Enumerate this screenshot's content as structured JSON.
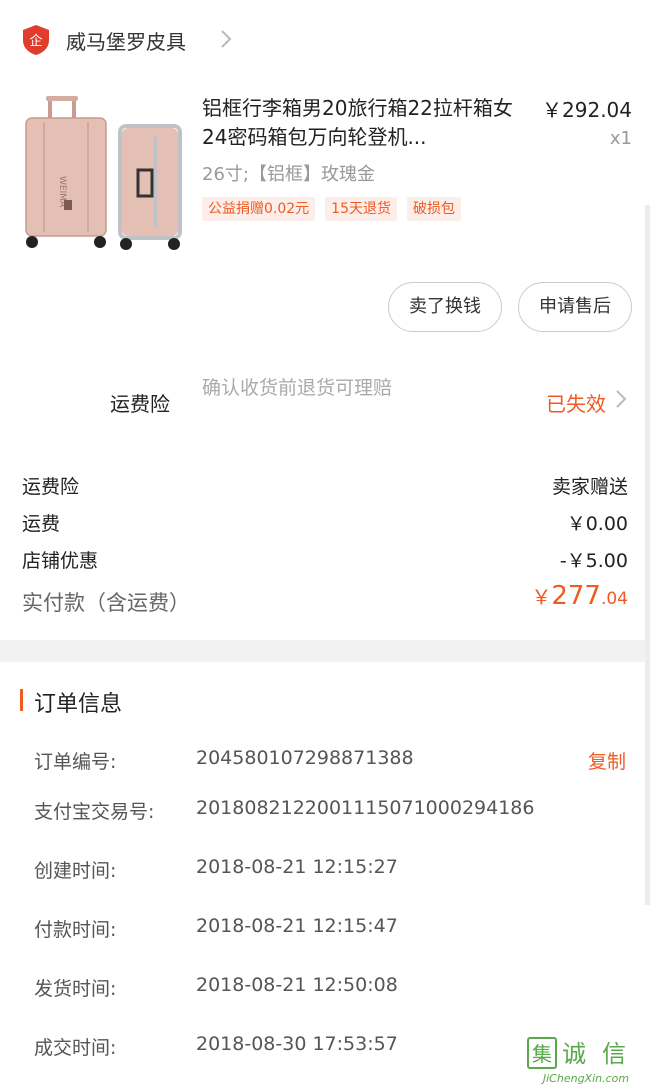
{
  "shop": {
    "name": "威马堡罗皮具",
    "logo_icon": "shop-logo-icon",
    "chevron_icon": "chevron-right-icon"
  },
  "product": {
    "title": "铝框行李箱男20旅行箱22拉杆箱女24密码箱包万向轮登机...",
    "price": "￥292.04",
    "quantity": "x1",
    "sku": "26寸;【铝框】玫瑰金",
    "tags": [
      "公益捐赠0.02元",
      "15天退货",
      "破损包"
    ],
    "image_brand_text": "WEIMA"
  },
  "actions": {
    "sell_label": "卖了换钱",
    "after_sale_label": "申请售后"
  },
  "insurance": {
    "label": "运费险",
    "description": "确认收货前退货可理赔",
    "status": "已失效"
  },
  "costs": {
    "rows": [
      {
        "label": "运费险",
        "value": "卖家赠送"
      },
      {
        "label": "运费",
        "value": "￥0.00"
      },
      {
        "label": "店铺优惠",
        "value": "-￥5.00"
      }
    ],
    "total_label": "实付款（含运费）",
    "total_currency": "￥",
    "total_integer": "277",
    "total_decimal": ".04"
  },
  "order_info": {
    "title": "订单信息",
    "copy_label": "复制",
    "rows": [
      {
        "label": "订单编号:",
        "value": "204580107298871388"
      },
      {
        "label": "支付宝交易号:",
        "value": "2018082122001115071000294186"
      },
      {
        "label": "创建时间:",
        "value": "2018-08-21 12:15:27"
      },
      {
        "label": "付款时间:",
        "value": "2018-08-21 12:15:47"
      },
      {
        "label": "发货时间:",
        "value": "2018-08-21 12:50:08"
      },
      {
        "label": "成交时间:",
        "value": "2018-08-30 17:53:57"
      }
    ]
  },
  "watermark": {
    "cn": "集诚信",
    "url": "JiChengXin.com"
  },
  "colors": {
    "accent": "#f05a23",
    "tag_bg": "#fdeee9",
    "muted": "#999999",
    "divider": "#f2f2f2"
  }
}
